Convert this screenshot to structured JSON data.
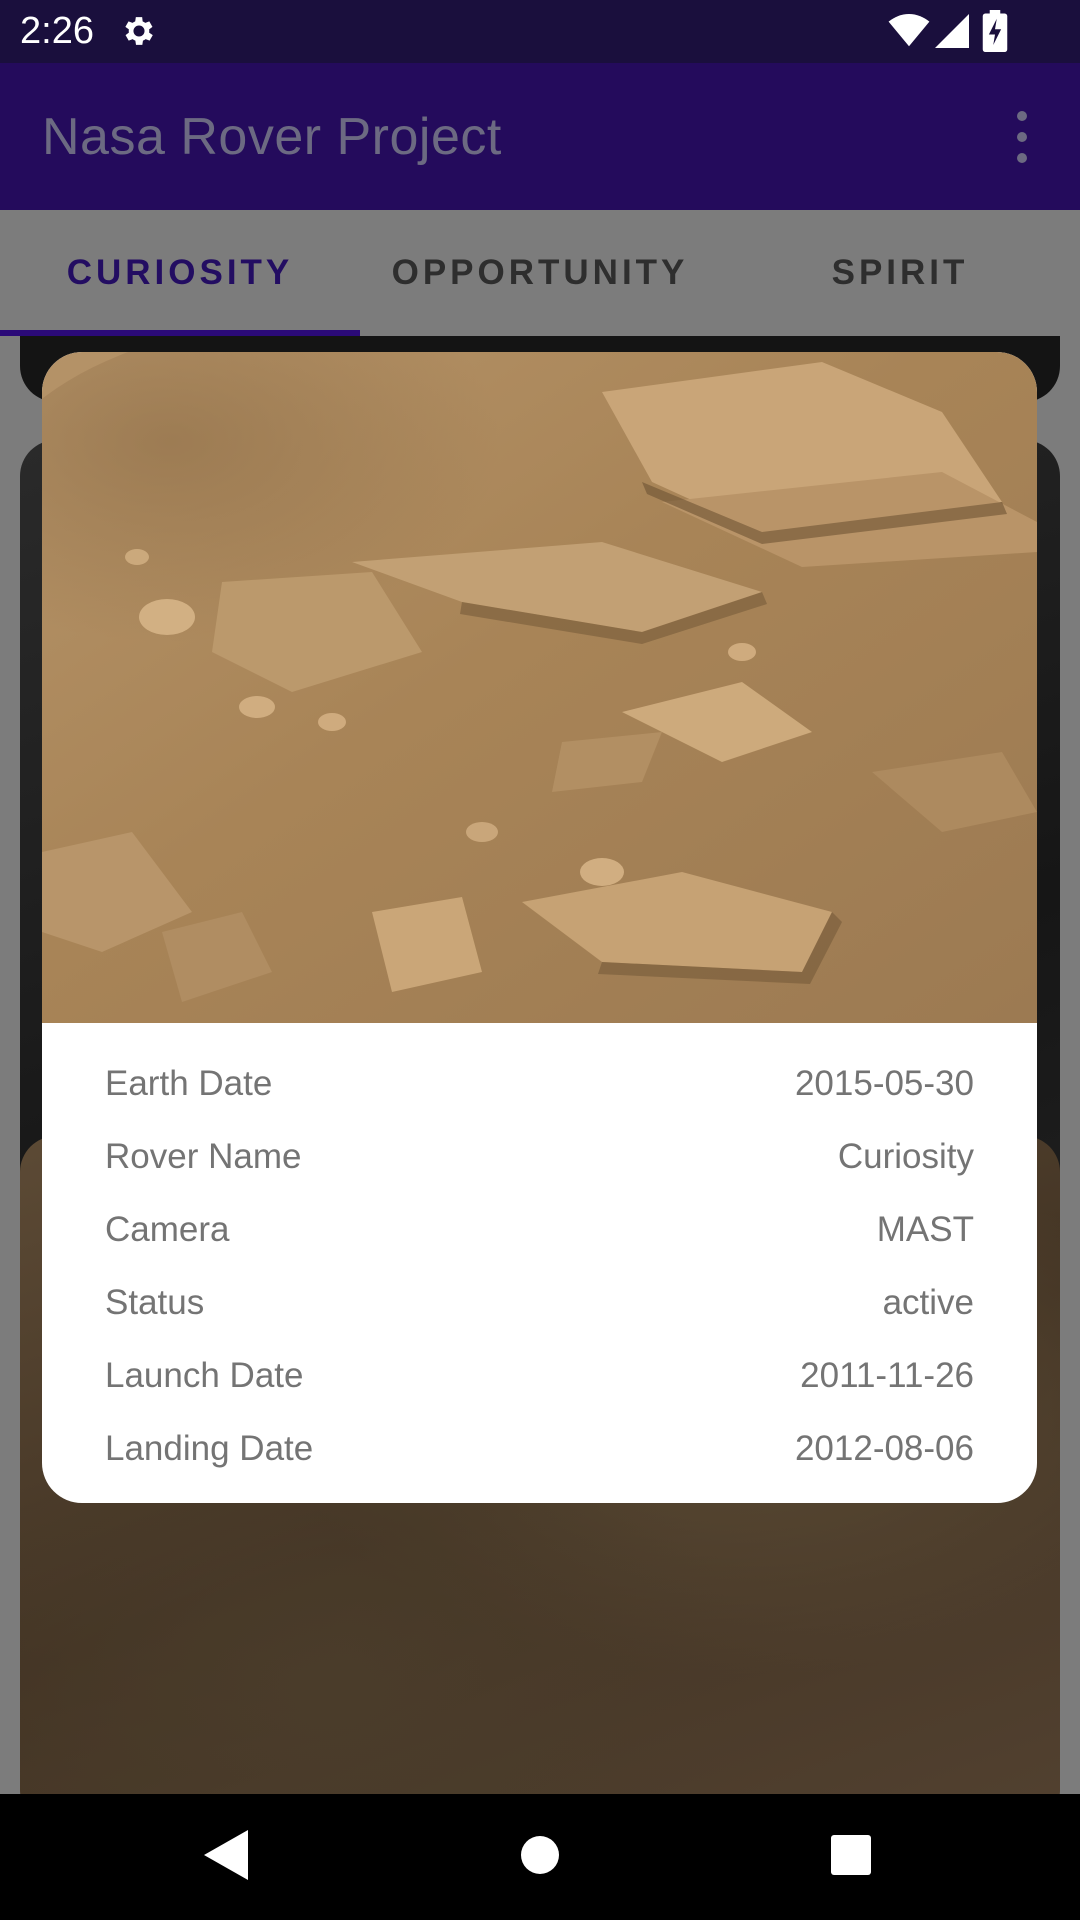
{
  "status_bar": {
    "time": "2:26",
    "icons": [
      "settings-gear-icon",
      "wifi-icon",
      "cell-signal-icon",
      "battery-charging-icon"
    ]
  },
  "app_bar": {
    "title": "Nasa Rover Project",
    "overflow_icon": "more-vert-icon"
  },
  "tabs": [
    {
      "label": "CURIOSITY",
      "active": true
    },
    {
      "label": "OPPORTUNITY",
      "active": false
    },
    {
      "label": "SPIRIT",
      "active": false
    }
  ],
  "dialog": {
    "rows": [
      {
        "label": "Earth Date",
        "value": "2015-05-30"
      },
      {
        "label": "Rover Name",
        "value": "Curiosity"
      },
      {
        "label": "Camera",
        "value": "MAST"
      },
      {
        "label": "Status",
        "value": "active"
      },
      {
        "label": "Launch Date",
        "value": "2011-11-26"
      },
      {
        "label": "Landing Date",
        "value": "2012-08-06"
      }
    ]
  },
  "nav_bar": {
    "icons": [
      "back-icon",
      "home-icon",
      "recents-icon"
    ]
  },
  "colors": {
    "status_bar": "#1a0f3d",
    "app_bar": "#240b5c",
    "tab_indicator": "#2b0a78",
    "scrim": "#7c7c7c"
  }
}
